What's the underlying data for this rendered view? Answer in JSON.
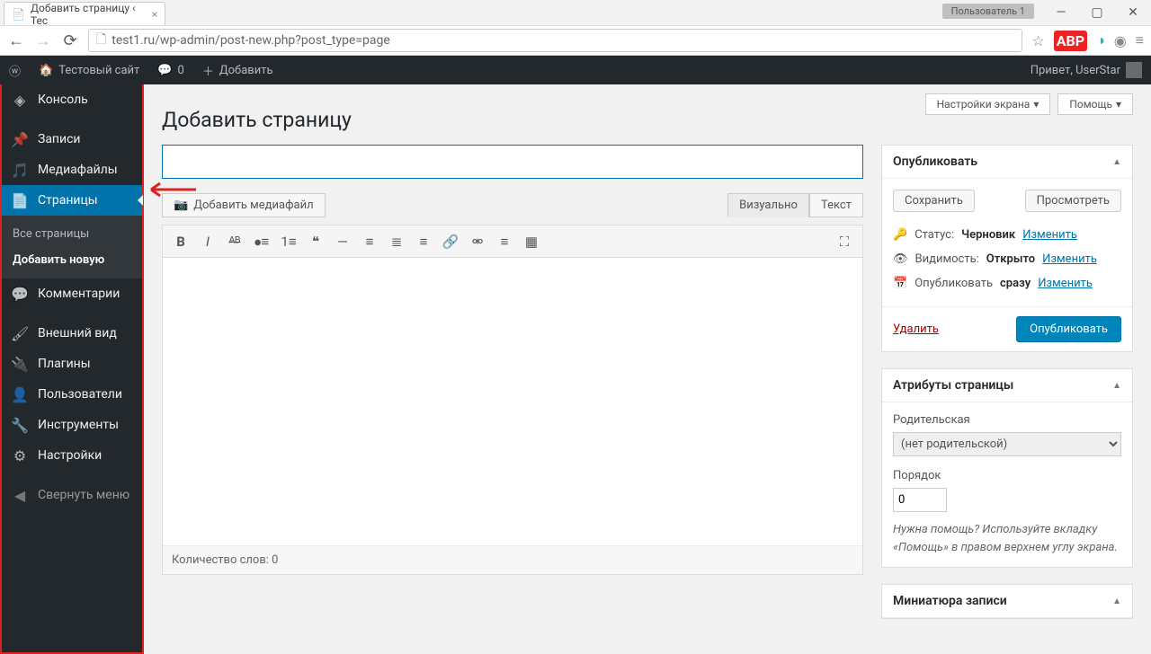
{
  "browser": {
    "tab_title": "Добавить страницу ‹ Тес",
    "user_badge": "Пользователь 1",
    "url": "test1.ru/wp-admin/post-new.php?post_type=page"
  },
  "toolbar": {
    "site_name": "Тестовый сайт",
    "comments_count": "0",
    "add_new": "Добавить",
    "greeting": "Привет, UserStar"
  },
  "sidebar": {
    "console": "Консоль",
    "posts": "Записи",
    "media": "Медиафайлы",
    "pages": "Страницы",
    "all_pages": "Все страницы",
    "add_new_page": "Добавить новую",
    "comments": "Комментарии",
    "appearance": "Внешний вид",
    "plugins": "Плагины",
    "users": "Пользователи",
    "tools": "Инструменты",
    "settings": "Настройки",
    "collapse": "Свернуть меню"
  },
  "screen_options": "Настройки экрана",
  "help": "Помощь",
  "page_heading": "Добавить страницу",
  "media_button": "Добавить медиафайл",
  "editor_tabs": {
    "visual": "Визуально",
    "text": "Текст"
  },
  "word_count": "Количество слов: 0",
  "publish_box": {
    "title": "Опубликовать",
    "save": "Сохранить",
    "preview": "Просмотреть",
    "status_label": "Статус:",
    "status_value": "Черновик",
    "visibility_label": "Видимость:",
    "visibility_value": "Открыто",
    "schedule_label": "Опубликовать",
    "schedule_value": "сразу",
    "edit": "Изменить",
    "delete": "Удалить",
    "publish": "Опубликовать"
  },
  "attributes_box": {
    "title": "Атрибуты страницы",
    "parent_label": "Родительская",
    "parent_value": "(нет родительской)",
    "order_label": "Порядок",
    "order_value": "0",
    "help": "Нужна помощь? Используйте вкладку «Помощь» в правом верхнем углу экрана."
  },
  "thumbnail_box": {
    "title": "Миниатюра записи"
  }
}
